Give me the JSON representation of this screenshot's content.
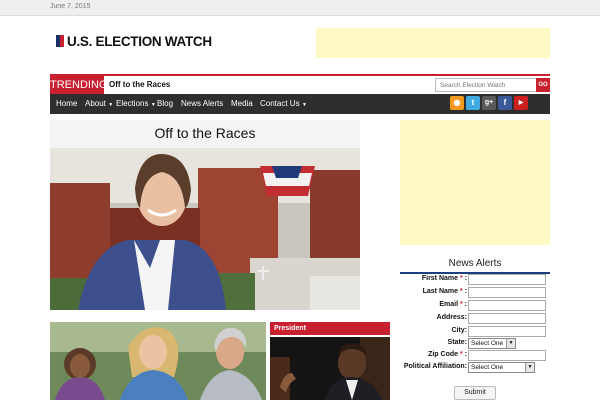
{
  "topbar": {
    "date": "June 7, 2015"
  },
  "logo": {
    "text": "U.S. ELECTION WATCH"
  },
  "trending": {
    "label": "TRENDING",
    "headline": "Off to the Races",
    "search_placeholder": "Search Election Watch",
    "go_label": "GO"
  },
  "nav": {
    "items": [
      {
        "label": "Home",
        "dropdown": false
      },
      {
        "label": "About",
        "dropdown": true
      },
      {
        "label": "Elections",
        "dropdown": true
      },
      {
        "label": "Blog",
        "dropdown": false
      },
      {
        "label": "News Alerts",
        "dropdown": false
      },
      {
        "label": "Media",
        "dropdown": false
      },
      {
        "label": "Contact Us",
        "dropdown": true
      }
    ],
    "social": [
      {
        "icon": "rss-icon",
        "glyph": "◉",
        "color": "#f39a1e"
      },
      {
        "icon": "twitter-icon",
        "glyph": "t",
        "color": "#3fa9e0"
      },
      {
        "icon": "googleplus-icon",
        "glyph": "g+",
        "color": "#5a5a5a"
      },
      {
        "icon": "facebook-icon",
        "glyph": "f",
        "color": "#3b5998"
      },
      {
        "icon": "youtube-icon",
        "glyph": "▶",
        "color": "#cc2020"
      }
    ]
  },
  "feature": {
    "title": "Off to the Races"
  },
  "news_alerts": {
    "heading": "News Alerts",
    "fields": [
      {
        "label": "First Name",
        "required": true,
        "type": "text"
      },
      {
        "label": "Last Name",
        "required": true,
        "type": "text"
      },
      {
        "label": "Email",
        "required": true,
        "type": "text"
      },
      {
        "label": "Address:",
        "required": false,
        "type": "text"
      },
      {
        "label": "City:",
        "required": false,
        "type": "text"
      },
      {
        "label": "State:",
        "required": false,
        "type": "select",
        "value": "Select One"
      },
      {
        "label": "Zip Code",
        "required": true,
        "type": "text"
      },
      {
        "label": "Political Affiliation:",
        "required": false,
        "type": "select",
        "value": "Select One"
      }
    ],
    "submit_label": "Submit"
  },
  "category": {
    "label": "President"
  },
  "colors": {
    "accent_red": "#c8202f",
    "nav_bg": "#2e2e2e",
    "ad_bg": "#fff9c4",
    "rule_blue": "#1b3f7a"
  }
}
